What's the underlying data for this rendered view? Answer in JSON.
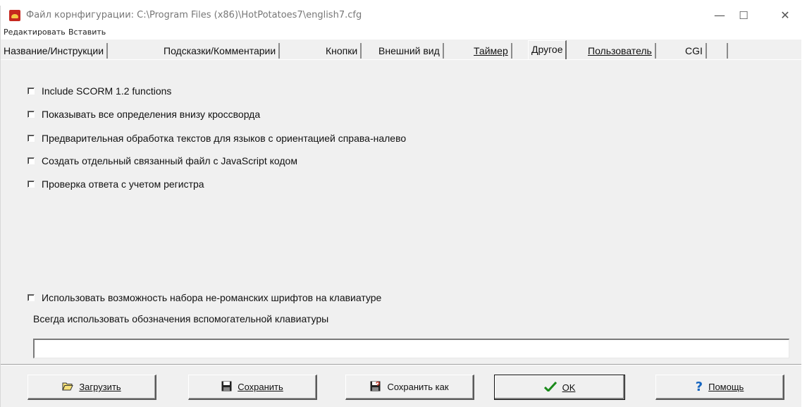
{
  "window": {
    "title": "Файл корнфигурации: C:\\Program Files (x86)\\HotPotatoes7\\english7.cfg",
    "minimize_glyph": "—",
    "maximize_glyph": "☐",
    "close_glyph": "✕"
  },
  "menu": {
    "items": [
      "Редактировать",
      "Вставить"
    ]
  },
  "tabs": [
    {
      "label": "Название/Инструкции"
    },
    {
      "label": "Подсказки/Комментарии"
    },
    {
      "label": "Кнопки"
    },
    {
      "label": "Внешний вид"
    },
    {
      "label": "Таймер"
    },
    {
      "label": "Другое",
      "active": true
    },
    {
      "label": "Пользователь"
    },
    {
      "label": "CGI"
    }
  ],
  "options": [
    {
      "label": "Include SCORM 1.2 functions",
      "checked": false
    },
    {
      "label": "Показывать все определения внизу кроссворда",
      "checked": false
    },
    {
      "label": "Предварительная обработка текстов для языков с ориентацией справа-налево",
      "checked": false
    },
    {
      "label": "Создать отдельный связанный файл с JavaScript кодом",
      "checked": false
    },
    {
      "label": "Проверка ответа с учетом регистра",
      "checked": false
    }
  ],
  "keyboard_option": {
    "label": "Использовать возможность набора не-романских шрифтов на клавиатуре",
    "checked": false
  },
  "keypad_label": "Всегда использовать обозначения вспомогательной клавиатуры",
  "keypad_value": "",
  "buttons": {
    "load": "Загрузить",
    "save": "Сохранить",
    "save_as": "Сохранить как",
    "ok": "OK",
    "help": "Помощь"
  },
  "colors": {
    "ok_check": "#1a8a1a",
    "help_icon": "#1565c0"
  }
}
